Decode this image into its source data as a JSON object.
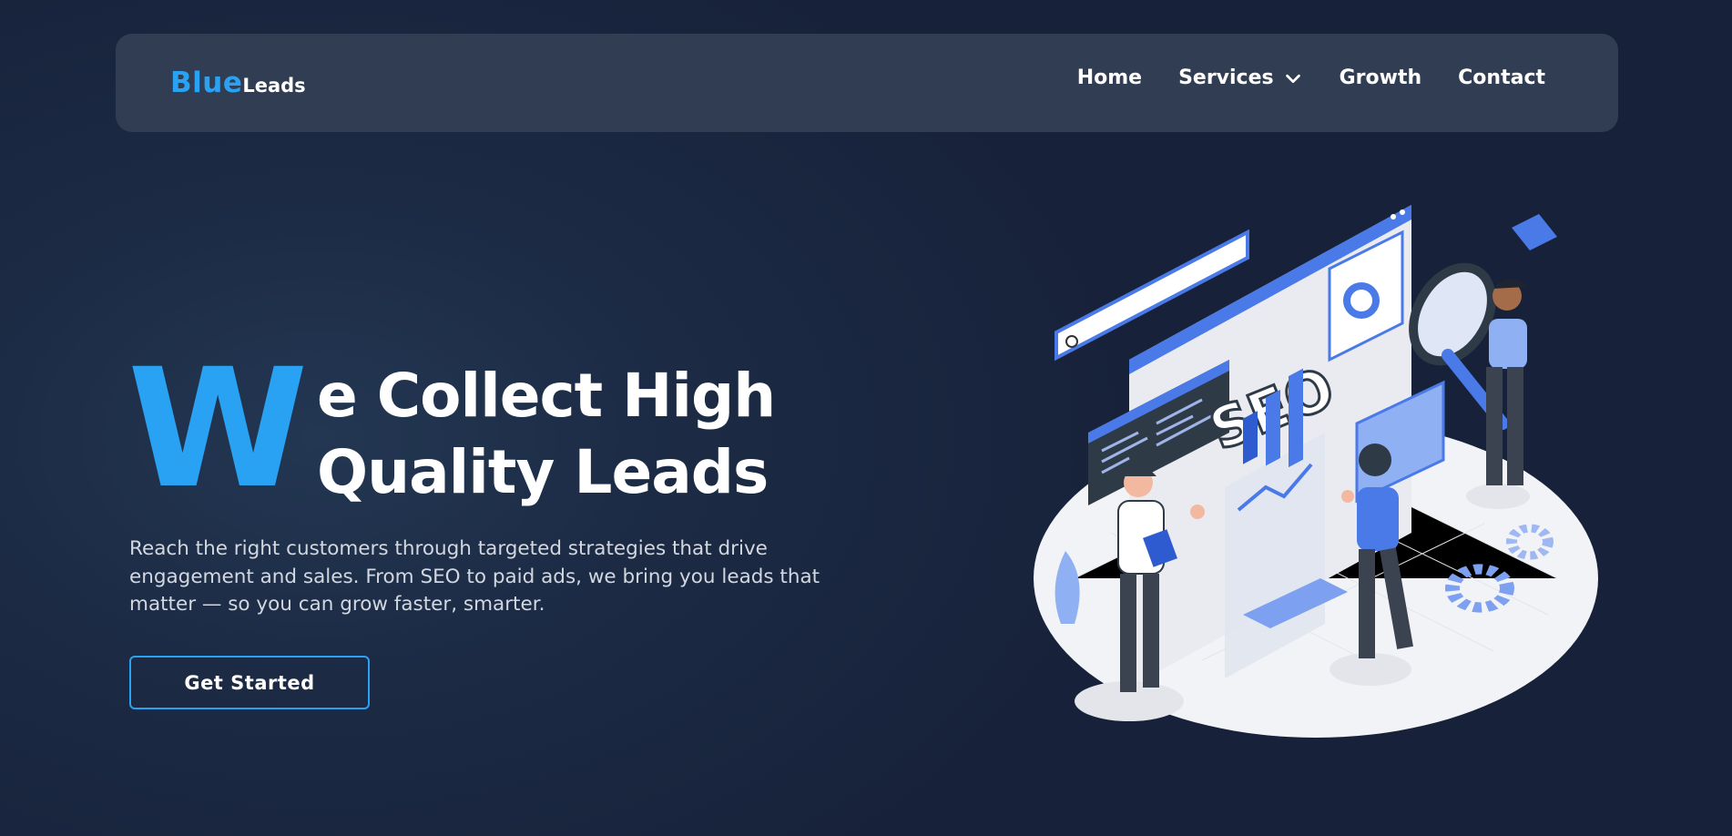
{
  "brand": {
    "part1": "Blue",
    "part2": "Leads"
  },
  "nav": {
    "items": [
      {
        "label": "Home"
      },
      {
        "label": "Services",
        "icon": "chevron-down-icon"
      },
      {
        "label": "Growth"
      },
      {
        "label": "Contact"
      }
    ]
  },
  "hero": {
    "big_letter": "W",
    "headline_line1": "e Collect High",
    "headline_line2": "Quality Leads",
    "subtitle": "Reach the right customers through targeted strategies that drive engagement and sales. From SEO to paid ads, we bring you leads that matter — so you can grow faster, smarter.",
    "cta_label": "Get Started"
  },
  "illustration": {
    "seo_text": "SEO"
  },
  "colors": {
    "accent": "#2aa2f3",
    "nav_bg": "#313d52",
    "illus_blue": "#4a79e8"
  }
}
